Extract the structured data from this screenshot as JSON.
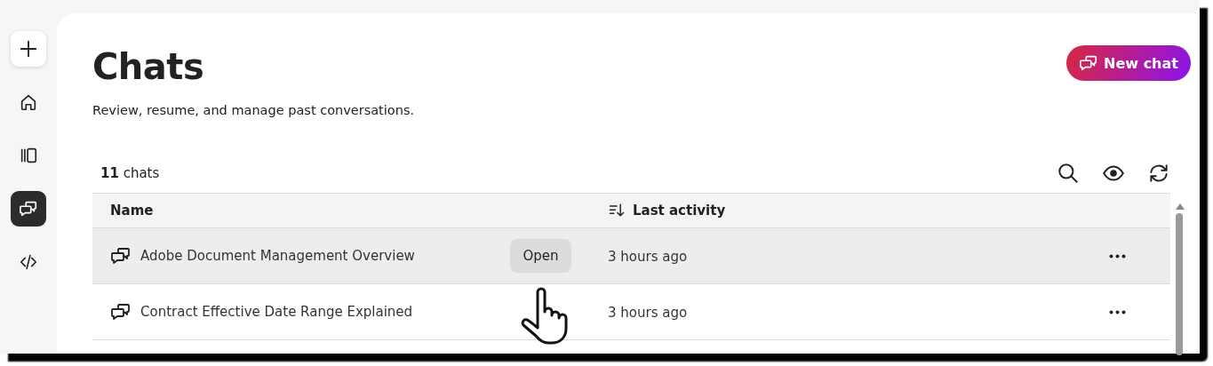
{
  "sidebar": {
    "items": [
      {
        "kind": "plus",
        "selected": false
      },
      {
        "kind": "home",
        "selected": false
      },
      {
        "kind": "library",
        "selected": false
      },
      {
        "kind": "chats",
        "selected": true
      },
      {
        "kind": "code",
        "selected": false
      }
    ]
  },
  "page": {
    "title": "Chats",
    "subtitle": "Review, resume, and manage past conversations.",
    "new_chat_button": "New chat",
    "count": "**11** chats"
  },
  "table": {
    "columns": [
      {
        "label": "Name",
        "sorted": false
      },
      {
        "label": "Last activity",
        "sorted": true
      }
    ],
    "rows": [
      {
        "name": "Adobe Document Management Overview",
        "open_button": "Open",
        "last_activity": "3 hours ago",
        "hovered": true
      },
      {
        "name": "Contract Effective Date Range Explained",
        "last_activity": "3 hours ago",
        "hovered": false
      }
    ]
  }
}
